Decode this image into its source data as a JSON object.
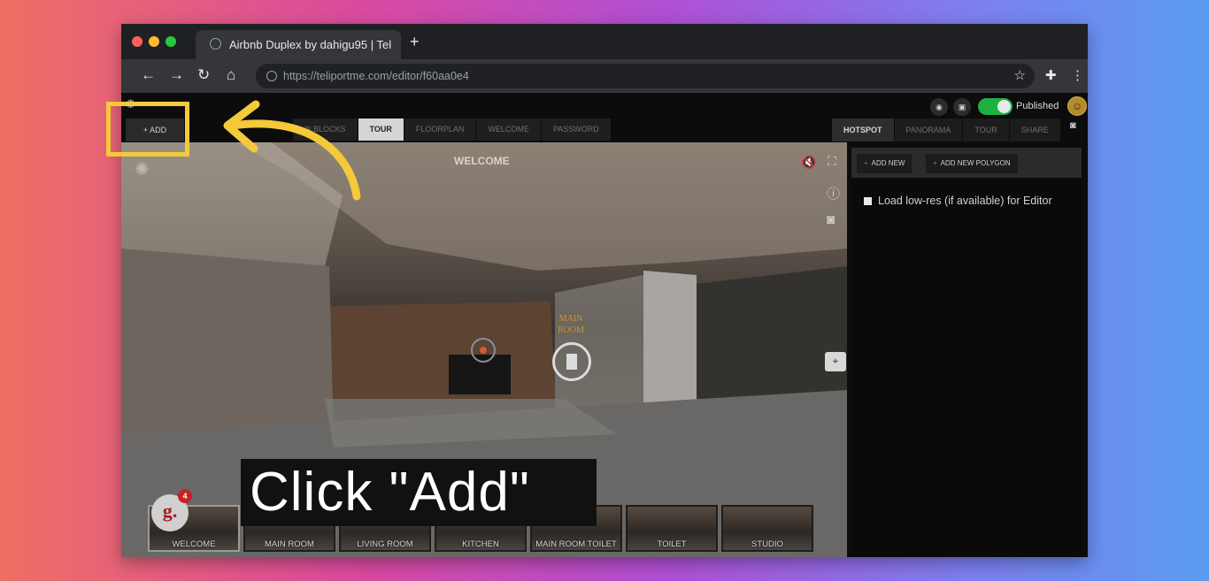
{
  "browser": {
    "tab_title": "Airbnb Duplex by dahigu95 | Tel",
    "new_tab_label": "+",
    "url": "https://teliportme.com/editor/f60aa0e4",
    "nav": {
      "back": "←",
      "forward": "→",
      "reload": "↻",
      "home": "⌂"
    },
    "star": "☆",
    "extensions": "✚",
    "menu": "⋮"
  },
  "editor": {
    "add_label": "+ ADD",
    "tabs": [
      "⊞ BLOCKS",
      "TOUR",
      "FLOORPLAN",
      "WELCOME",
      "PASSWORD"
    ],
    "active_tab": "TOUR",
    "publish_state": "Published",
    "right_tabs": [
      "HOTSPOT",
      "PANORAMA",
      "TOUR",
      "SHARE"
    ],
    "active_right_tab": "HOTSPOT",
    "add_new_label": "ADD NEW",
    "add_new_polygon_label": "ADD NEW POLYGON",
    "low_res_label": "Load low-res (if available) for Editor"
  },
  "viewer": {
    "scene_title": "WELCOME",
    "hotspot_label_line1": "MAIN",
    "hotspot_label_line2": "ROOM",
    "badge_letter": "g.",
    "badge_count": "4",
    "thumbnails": [
      "WELCOME",
      "MAIN ROOM",
      "LIVING ROOM",
      "KITCHEN",
      "MAIN ROOM TOILET",
      "TOILET",
      "STUDIO"
    ],
    "selected_thumbnail": "WELCOME"
  },
  "overlay": {
    "caption": "Click \"Add\"",
    "highlight_color": "#f4c93a"
  },
  "colors": {
    "publish_toggle": "#1fb13f",
    "accent_add": "#1fb13f"
  }
}
